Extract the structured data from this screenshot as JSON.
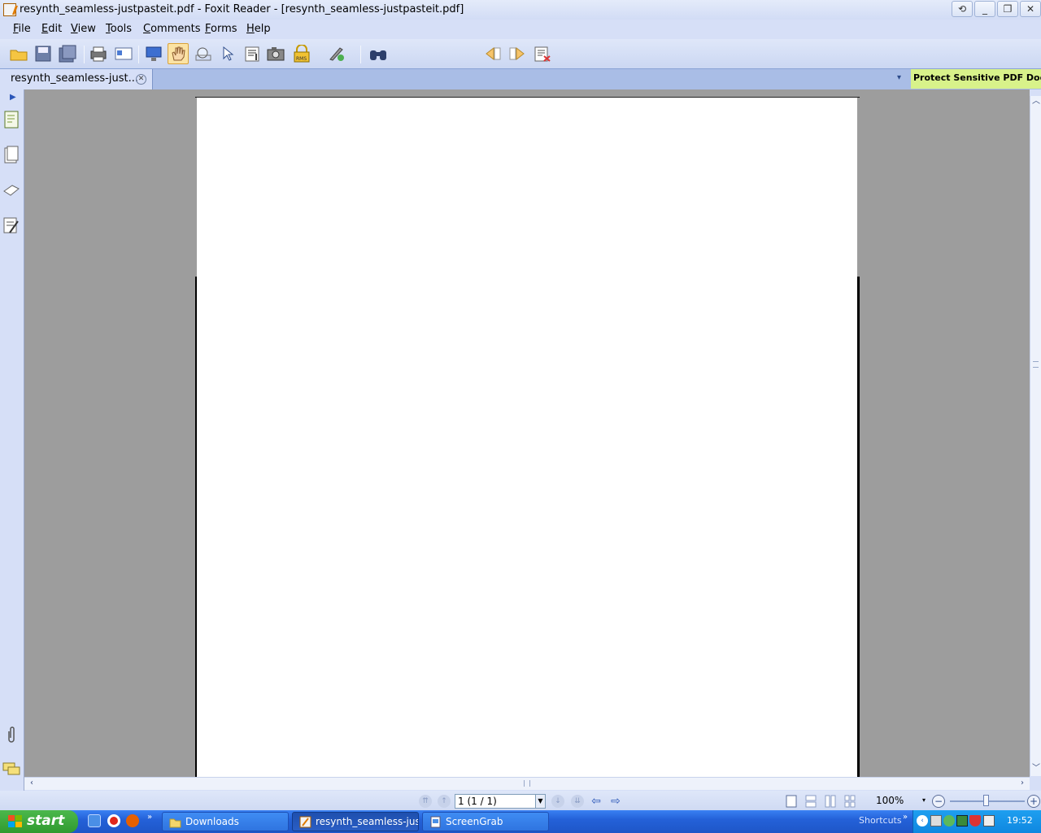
{
  "window": {
    "title": "resynth_seamless-justpasteit.pdf - Foxit Reader - [resynth_seamless-justpasteit.pdf]",
    "controls": [
      "restore-app",
      "minimize",
      "maximize",
      "close"
    ]
  },
  "menu": {
    "items": [
      {
        "first": "F",
        "rest": "ile"
      },
      {
        "first": "E",
        "rest": "dit"
      },
      {
        "first": "V",
        "rest": "iew"
      },
      {
        "first": "T",
        "rest": "ools"
      },
      {
        "first": "C",
        "rest": "omments"
      },
      {
        "first": "F",
        "rest": "orms"
      },
      {
        "first": "H",
        "rest": "elp"
      }
    ]
  },
  "toolbar": {
    "find_value": "",
    "active_tool": "hand"
  },
  "tabs": {
    "doc_label": "resynth_seamless-just...",
    "promo": "Protect Sensitive PDF Documents"
  },
  "status": {
    "page_value": "1 (1 / 1)",
    "zoom": "100%"
  },
  "taskbar": {
    "start": "start",
    "tasks": [
      "Downloads",
      "resynth_seamless-jus...",
      "ScreenGrab"
    ],
    "shortcuts": "Shortcuts",
    "clock": "19:52"
  },
  "colors": {
    "accent": "#2461d8",
    "promo": "#d8f28a",
    "doc_bg": "#9d9d9d"
  }
}
